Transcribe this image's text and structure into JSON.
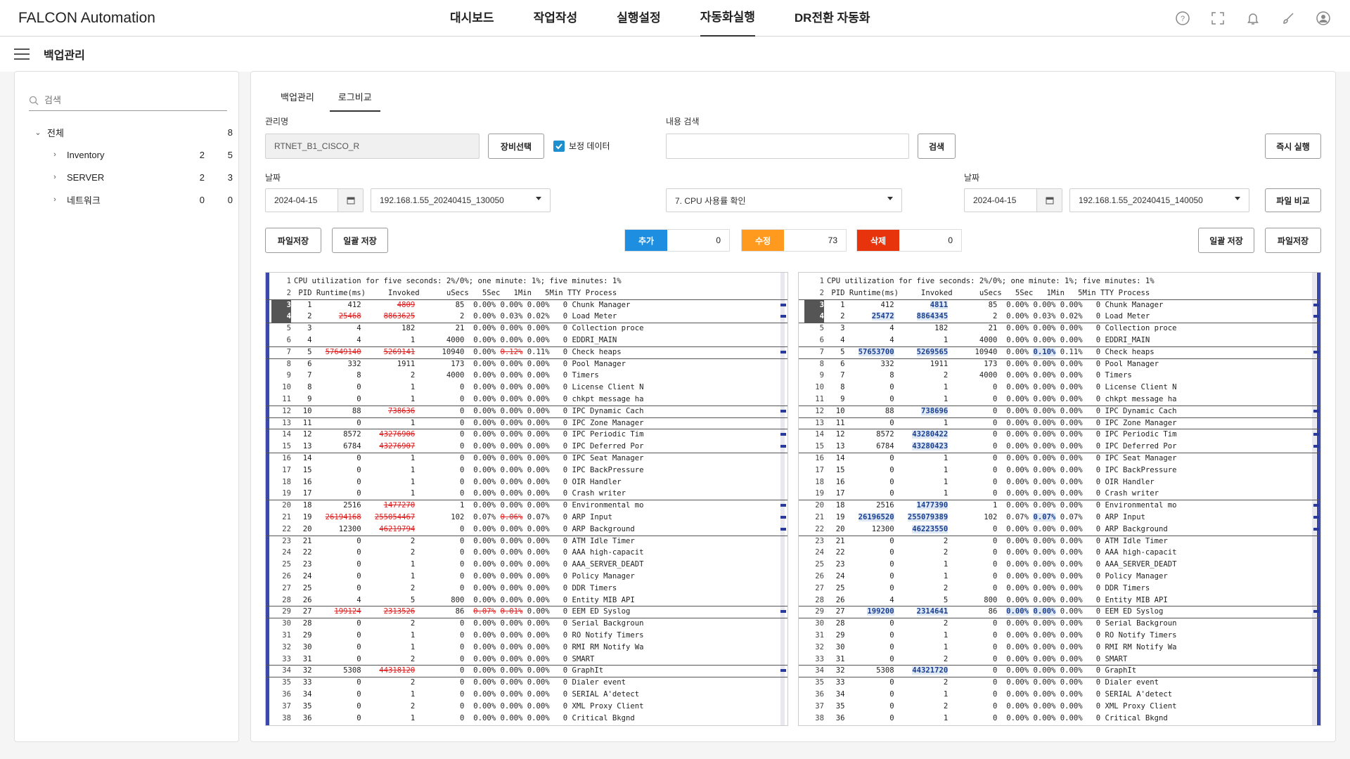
{
  "app": {
    "title": "FALCON Automation"
  },
  "nav": [
    "대시보드",
    "작업작성",
    "실행설정",
    "자동화실행",
    "DR전환 자동화"
  ],
  "page": {
    "title": "백업관리"
  },
  "sidebar": {
    "search_placeholder": "검색",
    "tree": [
      {
        "label": "전체",
        "a": "",
        "b": "8"
      },
      {
        "label": "Inventory",
        "a": "2",
        "b": "5"
      },
      {
        "label": "SERVER",
        "a": "2",
        "b": "3"
      },
      {
        "label": "네트워크",
        "a": "0",
        "b": "0"
      }
    ]
  },
  "tabs": [
    "백업관리",
    "로그비교"
  ],
  "form": {
    "mgmt_label": "관리명",
    "mgmt_value": "RTNET_B1_CISCO_R",
    "equip_btn": "장비선택",
    "correct_label": "보정 데이터",
    "content_search_label": "내용 검색",
    "search_btn": "검색",
    "run_btn": "즉시 실행",
    "date_label_left": "날짜",
    "date_left": "2024-04-15",
    "file_left": "192.168.1.55_20240415_130050",
    "cmd_select": "7. CPU 사용률 확인",
    "date_label_right": "날짜",
    "date_right": "2024-04-15",
    "file_right": "192.168.1.55_20240415_140050",
    "compare_btn": "파일 비교",
    "save_file_left": "파일저장",
    "save_all_left": "일괄 저장",
    "save_all_right": "일괄 저장",
    "save_file_right": "파일저장"
  },
  "stats": {
    "add_label": "추가",
    "add_value": "0",
    "mod_label": "수정",
    "mod_value": "73",
    "del_label": "삭제",
    "del_value": "0",
    "add_color": "#1e8fe0",
    "mod_color": "#ff9a1f",
    "del_color": "#e8340c"
  },
  "diff": {
    "header1": "CPU utilization for five seconds: 2%/0%; one minute: 1%; five minutes: 1%",
    "header2": " PID Runtime(ms)     Invoked      uSecs   5Sec   1Min   5Min TTY Process",
    "rows": [
      {
        "n": 3,
        "pid": "1",
        "rt": [
          "412",
          "412"
        ],
        "inv": [
          "4809",
          "4811"
        ],
        "us": "85",
        "s5": "0.00%",
        "m1": [
          "0.00%",
          "0.00%"
        ],
        "m5": "0.00%",
        "proc": "Chunk Manager",
        "c": [
          "inv"
        ]
      },
      {
        "n": 4,
        "pid": "2",
        "rt": [
          "25468",
          "25472"
        ],
        "inv": [
          "8863625",
          "8864345"
        ],
        "us": "2",
        "s5": "0.00%",
        "m1": [
          "0.03%",
          "0.03%"
        ],
        "m5": "0.02%",
        "proc": "Load Meter",
        "c": [
          "rt",
          "inv"
        ]
      },
      {
        "n": 5,
        "pid": "3",
        "rt": [
          "4",
          "4"
        ],
        "inv": [
          "182",
          "182"
        ],
        "us": "21",
        "s5": "0.00%",
        "m1": [
          "0.00%",
          "0.00%"
        ],
        "m5": "0.00%",
        "proc": "Collection proce",
        "c": []
      },
      {
        "n": 6,
        "pid": "4",
        "rt": [
          "4",
          "4"
        ],
        "inv": [
          "1",
          "1"
        ],
        "us": "4000",
        "s5": "0.00%",
        "m1": [
          "0.00%",
          "0.00%"
        ],
        "m5": "0.00%",
        "proc": "EDDRI_MAIN",
        "c": []
      },
      {
        "n": 7,
        "pid": "5",
        "rt": [
          "57649140",
          "57653700"
        ],
        "inv": [
          "5269141",
          "5269565"
        ],
        "us": "10940",
        "s5": "0.00%",
        "m1": [
          "0.12%",
          "0.10%"
        ],
        "m5": "0.11%",
        "proc": "Check heaps",
        "c": [
          "rt",
          "inv",
          "m1"
        ]
      },
      {
        "n": 8,
        "pid": "6",
        "rt": [
          "332",
          "332"
        ],
        "inv": [
          "1911",
          "1911"
        ],
        "us": "173",
        "s5": "0.00%",
        "m1": [
          "0.00%",
          "0.00%"
        ],
        "m5": "0.00%",
        "proc": "Pool Manager",
        "c": []
      },
      {
        "n": 9,
        "pid": "7",
        "rt": [
          "8",
          "8"
        ],
        "inv": [
          "2",
          "2"
        ],
        "us": "4000",
        "s5": "0.00%",
        "m1": [
          "0.00%",
          "0.00%"
        ],
        "m5": "0.00%",
        "proc": "Timers",
        "c": []
      },
      {
        "n": 10,
        "pid": "8",
        "rt": [
          "0",
          "0"
        ],
        "inv": [
          "1",
          "1"
        ],
        "us": "0",
        "s5": "0.00%",
        "m1": [
          "0.00%",
          "0.00%"
        ],
        "m5": "0.00%",
        "proc": "License Client N",
        "c": []
      },
      {
        "n": 11,
        "pid": "9",
        "rt": [
          "0",
          "0"
        ],
        "inv": [
          "1",
          "1"
        ],
        "us": "0",
        "s5": "0.00%",
        "m1": [
          "0.00%",
          "0.00%"
        ],
        "m5": "0.00%",
        "proc": "chkpt message ha",
        "c": []
      },
      {
        "n": 12,
        "pid": "10",
        "rt": [
          "88",
          "88"
        ],
        "inv": [
          "738636",
          "738696"
        ],
        "us": "0",
        "s5": "0.00%",
        "m1": [
          "0.00%",
          "0.00%"
        ],
        "m5": "0.00%",
        "proc": "IPC Dynamic Cach",
        "c": [
          "inv"
        ]
      },
      {
        "n": 13,
        "pid": "11",
        "rt": [
          "0",
          "0"
        ],
        "inv": [
          "1",
          "1"
        ],
        "us": "0",
        "s5": "0.00%",
        "m1": [
          "0.00%",
          "0.00%"
        ],
        "m5": "0.00%",
        "proc": "IPC Zone Manager",
        "c": []
      },
      {
        "n": 14,
        "pid": "12",
        "rt": [
          "8572",
          "8572"
        ],
        "inv": [
          "43276906",
          "43280422"
        ],
        "us": "0",
        "s5": "0.00%",
        "m1": [
          "0.00%",
          "0.00%"
        ],
        "m5": "0.00%",
        "proc": "IPC Periodic Tim",
        "c": [
          "inv"
        ]
      },
      {
        "n": 15,
        "pid": "13",
        "rt": [
          "6784",
          "6784"
        ],
        "inv": [
          "43276907",
          "43280423"
        ],
        "us": "0",
        "s5": "0.00%",
        "m1": [
          "0.00%",
          "0.00%"
        ],
        "m5": "0.00%",
        "proc": "IPC Deferred Por",
        "c": [
          "inv"
        ]
      },
      {
        "n": 16,
        "pid": "14",
        "rt": [
          "0",
          "0"
        ],
        "inv": [
          "1",
          "1"
        ],
        "us": "0",
        "s5": "0.00%",
        "m1": [
          "0.00%",
          "0.00%"
        ],
        "m5": "0.00%",
        "proc": "IPC Seat Manager",
        "c": []
      },
      {
        "n": 17,
        "pid": "15",
        "rt": [
          "0",
          "0"
        ],
        "inv": [
          "1",
          "1"
        ],
        "us": "0",
        "s5": "0.00%",
        "m1": [
          "0.00%",
          "0.00%"
        ],
        "m5": "0.00%",
        "proc": "IPC BackPressure",
        "c": []
      },
      {
        "n": 18,
        "pid": "16",
        "rt": [
          "0",
          "0"
        ],
        "inv": [
          "1",
          "1"
        ],
        "us": "0",
        "s5": "0.00%",
        "m1": [
          "0.00%",
          "0.00%"
        ],
        "m5": "0.00%",
        "proc": "OIR Handler",
        "c": []
      },
      {
        "n": 19,
        "pid": "17",
        "rt": [
          "0",
          "0"
        ],
        "inv": [
          "1",
          "1"
        ],
        "us": "0",
        "s5": "0.00%",
        "m1": [
          "0.00%",
          "0.00%"
        ],
        "m5": "0.00%",
        "proc": "Crash writer",
        "c": []
      },
      {
        "n": 20,
        "pid": "18",
        "rt": [
          "2516",
          "2516"
        ],
        "inv": [
          "1477270",
          "1477390"
        ],
        "us": "1",
        "s5": "0.00%",
        "m1": [
          "0.00%",
          "0.00%"
        ],
        "m5": "0.00%",
        "proc": "Environmental mo",
        "c": [
          "inv"
        ]
      },
      {
        "n": 21,
        "pid": "19",
        "rt": [
          "26194168",
          "26196520"
        ],
        "inv": [
          "255054467",
          "255079389"
        ],
        "us": "102",
        "s5": "0.07%",
        "m1": [
          "0.06%",
          "0.07%"
        ],
        "m5": "0.07%",
        "proc": "ARP Input",
        "c": [
          "rt",
          "inv",
          "m1"
        ]
      },
      {
        "n": 22,
        "pid": "20",
        "rt": [
          "12300",
          "12300"
        ],
        "inv": [
          "46219794",
          "46223550"
        ],
        "us": "0",
        "s5": "0.00%",
        "m1": [
          "0.00%",
          "0.00%"
        ],
        "m5": "0.00%",
        "proc": "ARP Background",
        "c": [
          "inv"
        ]
      },
      {
        "n": 23,
        "pid": "21",
        "rt": [
          "0",
          "0"
        ],
        "inv": [
          "2",
          "2"
        ],
        "us": "0",
        "s5": "0.00%",
        "m1": [
          "0.00%",
          "0.00%"
        ],
        "m5": "0.00%",
        "proc": "ATM Idle Timer",
        "c": []
      },
      {
        "n": 24,
        "pid": "22",
        "rt": [
          "0",
          "0"
        ],
        "inv": [
          "2",
          "2"
        ],
        "us": "0",
        "s5": "0.00%",
        "m1": [
          "0.00%",
          "0.00%"
        ],
        "m5": "0.00%",
        "proc": "AAA high-capacit",
        "c": []
      },
      {
        "n": 25,
        "pid": "23",
        "rt": [
          "0",
          "0"
        ],
        "inv": [
          "1",
          "1"
        ],
        "us": "0",
        "s5": "0.00%",
        "m1": [
          "0.00%",
          "0.00%"
        ],
        "m5": "0.00%",
        "proc": "AAA_SERVER_DEADT",
        "c": []
      },
      {
        "n": 26,
        "pid": "24",
        "rt": [
          "0",
          "0"
        ],
        "inv": [
          "1",
          "1"
        ],
        "us": "0",
        "s5": "0.00%",
        "m1": [
          "0.00%",
          "0.00%"
        ],
        "m5": "0.00%",
        "proc": "Policy Manager",
        "c": []
      },
      {
        "n": 27,
        "pid": "25",
        "rt": [
          "0",
          "0"
        ],
        "inv": [
          "2",
          "2"
        ],
        "us": "0",
        "s5": "0.00%",
        "m1": [
          "0.00%",
          "0.00%"
        ],
        "m5": "0.00%",
        "proc": "DDR Timers",
        "c": []
      },
      {
        "n": 28,
        "pid": "26",
        "rt": [
          "4",
          "4"
        ],
        "inv": [
          "5",
          "5"
        ],
        "us": "800",
        "s5": "0.00%",
        "m1": [
          "0.00%",
          "0.00%"
        ],
        "m5": "0.00%",
        "proc": "Entity MIB API",
        "c": []
      },
      {
        "n": 29,
        "pid": "27",
        "rt": [
          "199124",
          "199200"
        ],
        "inv": [
          "2313526",
          "2314641"
        ],
        "us": "86",
        "s5": [
          "0.07%",
          "0.00%"
        ],
        "m1": [
          "0.01%",
          "0.00%"
        ],
        "m5": "0.00%",
        "proc": "EEM ED Syslog",
        "c": [
          "rt",
          "inv",
          "s5",
          "m1"
        ]
      },
      {
        "n": 30,
        "pid": "28",
        "rt": [
          "0",
          "0"
        ],
        "inv": [
          "2",
          "2"
        ],
        "us": "0",
        "s5": "0.00%",
        "m1": [
          "0.00%",
          "0.00%"
        ],
        "m5": "0.00%",
        "proc": "Serial Backgroun",
        "c": []
      },
      {
        "n": 31,
        "pid": "29",
        "rt": [
          "0",
          "0"
        ],
        "inv": [
          "1",
          "1"
        ],
        "us": "0",
        "s5": "0.00%",
        "m1": [
          "0.00%",
          "0.00%"
        ],
        "m5": "0.00%",
        "proc": "RO Notify Timers",
        "c": []
      },
      {
        "n": 32,
        "pid": "30",
        "rt": [
          "0",
          "0"
        ],
        "inv": [
          "1",
          "1"
        ],
        "us": "0",
        "s5": "0.00%",
        "m1": [
          "0.00%",
          "0.00%"
        ],
        "m5": "0.00%",
        "proc": "RMI RM Notify Wa",
        "c": []
      },
      {
        "n": 33,
        "pid": "31",
        "rt": [
          "0",
          "0"
        ],
        "inv": [
          "2",
          "2"
        ],
        "us": "0",
        "s5": "0.00%",
        "m1": [
          "0.00%",
          "0.00%"
        ],
        "m5": "0.00%",
        "proc": "SMART",
        "c": []
      },
      {
        "n": 34,
        "pid": "32",
        "rt": [
          "5308",
          "5308"
        ],
        "inv": [
          "44318120",
          "44321720"
        ],
        "us": "0",
        "s5": "0.00%",
        "m1": [
          "0.00%",
          "0.00%"
        ],
        "m5": "0.00%",
        "proc": "GraphIt",
        "c": [
          "inv"
        ]
      },
      {
        "n": 35,
        "pid": "33",
        "rt": [
          "0",
          "0"
        ],
        "inv": [
          "2",
          "2"
        ],
        "us": "0",
        "s5": "0.00%",
        "m1": [
          "0.00%",
          "0.00%"
        ],
        "m5": "0.00%",
        "proc": "Dialer event",
        "c": []
      },
      {
        "n": 36,
        "pid": "34",
        "rt": [
          "0",
          "0"
        ],
        "inv": [
          "1",
          "1"
        ],
        "us": "0",
        "s5": "0.00%",
        "m1": [
          "0.00%",
          "0.00%"
        ],
        "m5": "0.00%",
        "proc": "SERIAL A'detect",
        "c": []
      },
      {
        "n": 37,
        "pid": "35",
        "rt": [
          "0",
          "0"
        ],
        "inv": [
          "2",
          "2"
        ],
        "us": "0",
        "s5": "0.00%",
        "m1": [
          "0.00%",
          "0.00%"
        ],
        "m5": "0.00%",
        "proc": "XML Proxy Client",
        "c": []
      },
      {
        "n": 38,
        "pid": "36",
        "rt": [
          "0",
          "0"
        ],
        "inv": [
          "1",
          "1"
        ],
        "us": "0",
        "s5": "0.00%",
        "m1": [
          "0.00%",
          "0.00%"
        ],
        "m5": "0.00%",
        "proc": "Critical Bkgnd",
        "c": []
      }
    ]
  }
}
